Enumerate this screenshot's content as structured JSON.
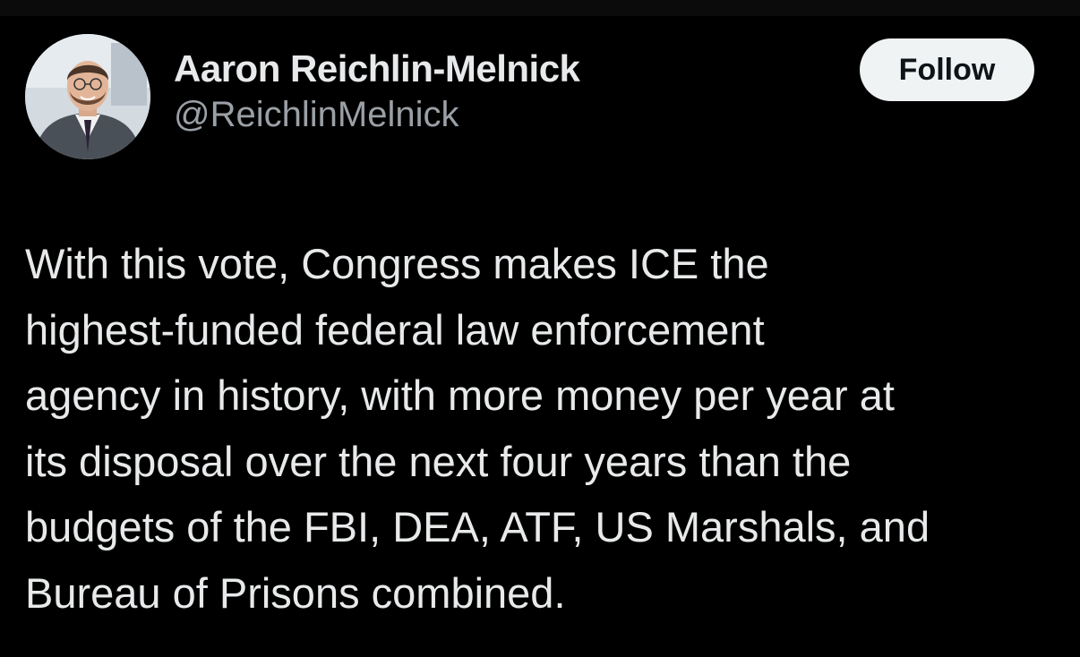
{
  "author": {
    "display_name": "Aaron Reichlin-Melnick",
    "handle": "@ReichlinMelnick",
    "avatar_icon": "profile-photo"
  },
  "actions": {
    "follow_label": "Follow"
  },
  "tweet": {
    "lines": [
      "With this vote, Congress makes ICE the",
      "highest-funded federal law enforcement",
      "agency in history, with more money per year at",
      "its disposal over the next four years than the",
      "budgets of the FBI, DEA, ATF, US Marshals, and",
      "Bureau of Prisons combined."
    ]
  },
  "colors": {
    "background": "#000000",
    "text_primary": "#e7e9ea",
    "text_secondary": "#9aa0a6",
    "follow_button_bg": "#eff3f4",
    "follow_button_text": "#0f1419"
  }
}
